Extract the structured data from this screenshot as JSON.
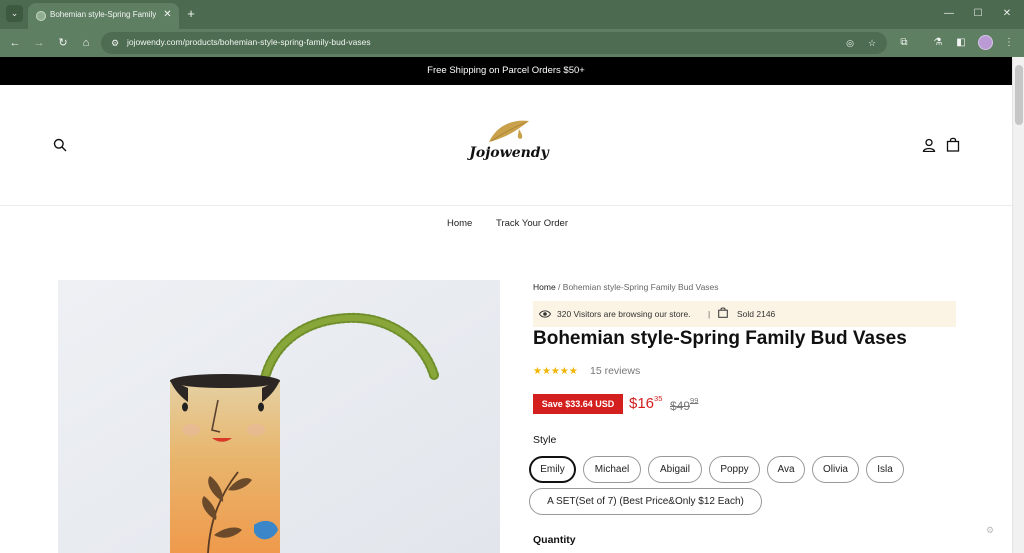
{
  "browser": {
    "tab_title": "Bohemian style-Spring Family B",
    "tab_close": "✕",
    "new_tab": "+",
    "url": "jojowendy.com/products/bohemian-style-spring-family-bud-vases",
    "controls": {
      "minimize": "—",
      "maximize": "☐",
      "close": "✕"
    },
    "icons": [
      "tab-search-icon",
      "back-icon",
      "forward-icon",
      "reload-icon",
      "home-icon",
      "site-info-icon",
      "eye-off-icon",
      "star-icon",
      "extensions-icon",
      "labs-icon",
      "side-panel-icon",
      "profile-avatar",
      "menu-icon"
    ]
  },
  "announcement": "Free Shipping on Parcel Orders $50+",
  "header": {
    "logo_text": "Jojowendy",
    "nav": [
      "Home",
      "Track Your Order"
    ]
  },
  "breadcrumb": {
    "home": "Home",
    "separator": " / ",
    "current": "Bohemian style-Spring Family Bud Vases"
  },
  "visitors": {
    "text": "320 Visitors are browsing our store.",
    "separator": "|",
    "sold": "Sold 2146"
  },
  "product": {
    "title": "Bohemian style-Spring Family Bud Vases",
    "stars": "★★★★★",
    "rating": 5,
    "reviews": "15 reviews",
    "save_badge": "Save $33.64 USD",
    "price_now_main": "$16",
    "price_now_cents": "35",
    "price_old_main": "$49",
    "price_old_cents": "99",
    "style_label": "Style",
    "styles": [
      "Emily",
      "Michael",
      "Abigail",
      "Poppy",
      "Ava",
      "Olivia",
      "Isla",
      "A SET(Set of 7)   (Best Price&Only $12 Each)"
    ],
    "selected_style": "Emily",
    "quantity_label": "Quantity"
  },
  "colors": {
    "chrome": "#4b6a4f",
    "toolbar": "#5f7f63",
    "sale_red": "#d41f1f",
    "star_gold": "#f2b400",
    "visitor_bg": "#fbf4e4"
  }
}
